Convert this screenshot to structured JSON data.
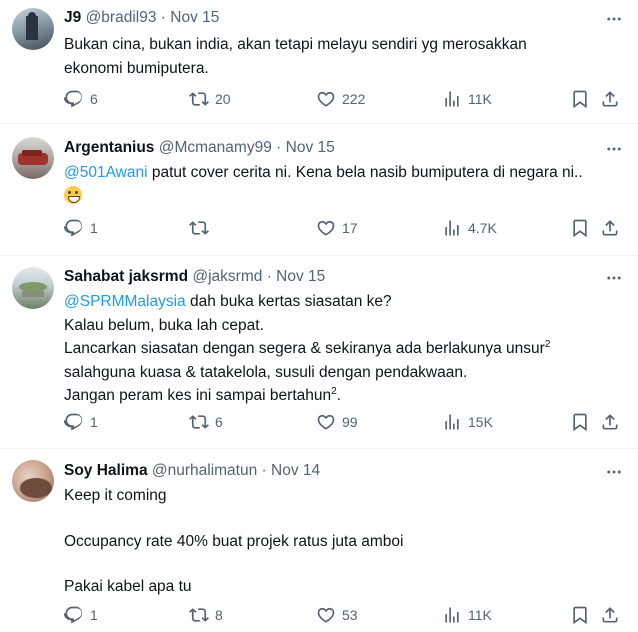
{
  "tweets": [
    {
      "name": "J9",
      "handle": "@bradil93",
      "sep": "·",
      "date": "Nov 15",
      "text": "Bukan cina, bukan india, akan tetapi melayu sendiri yg merosakkan ekonomi bumiputera.",
      "replies": "6",
      "retweets": "20",
      "likes": "222",
      "views": "11K"
    },
    {
      "name": "Argentanius",
      "handle": "@Mcmanamy99",
      "sep": "·",
      "date": "Nov 15",
      "mention": "@501Awani",
      "text": " patut cover cerita ni. Kena bela nasib bumiputera di negara ni..",
      "emoji": "grinning-face-emoji",
      "replies": "1",
      "retweets": "",
      "likes": "17",
      "views": "4.7K"
    },
    {
      "name": "Sahabat jaksrmd",
      "handle": "@jaksrmd",
      "sep": "·",
      "date": "Nov 15",
      "mention": "@SPRMMalaysia",
      "line1": " dah buka kertas siasatan ke?",
      "line2": "Kalau belum, buka lah cepat.",
      "line3": "Lancarkan siasatan  dengan segera & sekiranya ada berlakunya unsur",
      "sup1": "2",
      "line4": "salahguna kuasa & tatakelola, susuli dengan pendakwaan.",
      "line5": "Jangan peram kes ini sampai bertahun",
      "sup2": "2",
      "line5end": ".",
      "replies": "1",
      "retweets": "6",
      "likes": "99",
      "views": "15K"
    },
    {
      "name": "Soy Halima",
      "handle": "@nurhalimatun",
      "sep": "·",
      "date": "Nov 14",
      "line1": "Keep it coming",
      "line2": "Occupancy rate 40% buat projek ratus juta amboi",
      "line3": "Pakai kabel apa tu",
      "replies": "1",
      "retweets": "8",
      "likes": "53",
      "views": "11K"
    }
  ],
  "colors": {
    "text": "#0f1419",
    "secondary": "#536471",
    "link": "#1d9bf0",
    "divider": "#eff3f4"
  }
}
